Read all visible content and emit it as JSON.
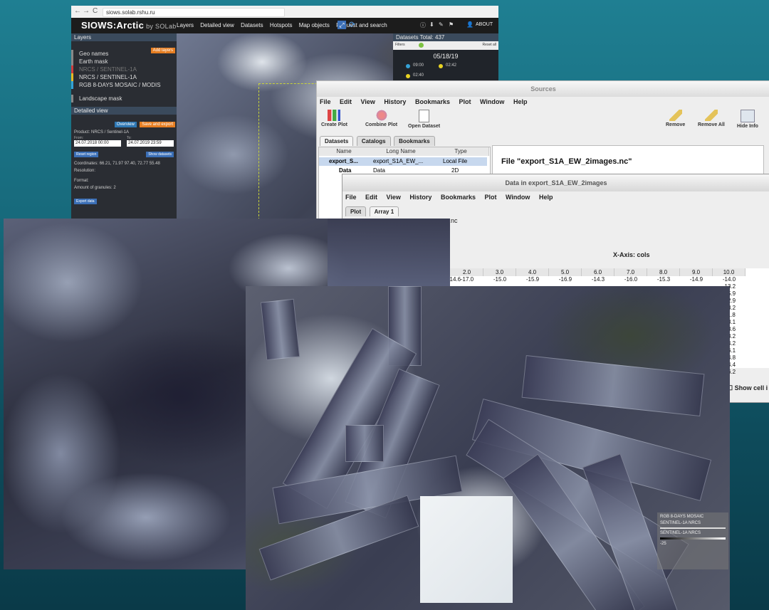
{
  "browser": {
    "url": "siows.solab.rshu.ru",
    "nav": {
      "back": "←",
      "forward": "→",
      "reload": "C"
    },
    "logo": "SIOWS:Arctic",
    "logo_by": "by SOLab",
    "menu": [
      "Layers",
      "Detailed view",
      "Datasets",
      "Hotspots",
      "Map objects",
      "Request and search"
    ],
    "about": "ABOUT",
    "layers_panel": {
      "title": "Layers",
      "add_button": "Add layers",
      "items": [
        "Geo names",
        "Earth mask",
        "NRCS / SENTINEL-1A",
        "NRCS / SENTINEL-1A",
        "RGB 8-DAYS MOSAIC / MODIS",
        "Landscape mask"
      ]
    },
    "detailed_view": {
      "title": "Detailed view",
      "overview_btn": "Overview",
      "save_btn": "Save and export",
      "product": "Product: NRCS / Sentinel-1A",
      "from_label": "From:",
      "from_value": "24.07.2018 00:00",
      "to_label": "To:",
      "to_value": "24.07.2019 23:59",
      "reset_btn": "Reset region",
      "show_btn": "Show datasets",
      "coordinates": "Coordinates:",
      "coord_value": "66.21, 71.97 97.40, 72.77 55.48",
      "resolution": "Resolution:",
      "format": "Format:",
      "granules": "Amount of granules: 2",
      "export_btn": "Export data"
    },
    "datasets_panel": {
      "title": "Datasets",
      "total": "Total: 437",
      "filters": "Filters",
      "reset": "Reset all",
      "date": "05/18/19",
      "times": [
        "09:00",
        "02:42",
        "02:40"
      ]
    }
  },
  "sources": {
    "title": "Sources",
    "menu": [
      "File",
      "Edit",
      "View",
      "History",
      "Bookmarks",
      "Plot",
      "Window",
      "Help"
    ],
    "toolbar": [
      "Create Plot",
      "Combine Plot",
      "Open Dataset",
      "Remove",
      "Remove All",
      "Hide Info"
    ],
    "tabs": [
      "Datasets",
      "Catalogs",
      "Bookmarks"
    ],
    "columns": [
      "Name",
      "Long Name",
      "Type"
    ],
    "rows": [
      {
        "name": "export_S...",
        "long": "export_S1A_EW_...",
        "type": "Local File"
      },
      {
        "name": "Data",
        "long": "Data",
        "type": "2D"
      }
    ],
    "file_label": "File \"export_S1A_EW_2images.nc\""
  },
  "data_window": {
    "title": "Data in export_S1A_EW_2images",
    "menu": [
      "File",
      "Edit",
      "View",
      "History",
      "Bookmarks",
      "Plot",
      "Window",
      "Help"
    ],
    "tabs": [
      "Plot",
      "Array 1"
    ],
    "file_partial": "es.nc",
    "xaxis_label": "X-Axis: cols",
    "col_headers": [
      "2.0",
      "3.0",
      "4.0",
      "5.0",
      "6.0",
      "7.0",
      "8.0",
      "9.0",
      "10.0"
    ],
    "first_row": [
      "-14.6",
      "-17.0",
      "-15.0",
      "-15.9",
      "-16.9",
      "-14.3",
      "-16.0",
      "-15.3",
      "-14.9",
      "-14.0"
    ],
    "last_col": [
      "-14.0",
      "-13.2",
      "-15.9",
      "-12.9",
      "-13.2",
      "-11.8",
      "-13.1",
      "-13.6",
      "-13.2",
      "-14.2",
      "-16.1",
      "-14.8",
      "-14.4",
      "-16.2"
    ],
    "show_cell": "Show cell i"
  },
  "legend": {
    "line1": "RGB 8-DAYS MOSAIC",
    "line2": "SENTINEL-1A NRCS",
    "line3": "SENTINEL-1A NRCS",
    "scale_min": "-25"
  }
}
